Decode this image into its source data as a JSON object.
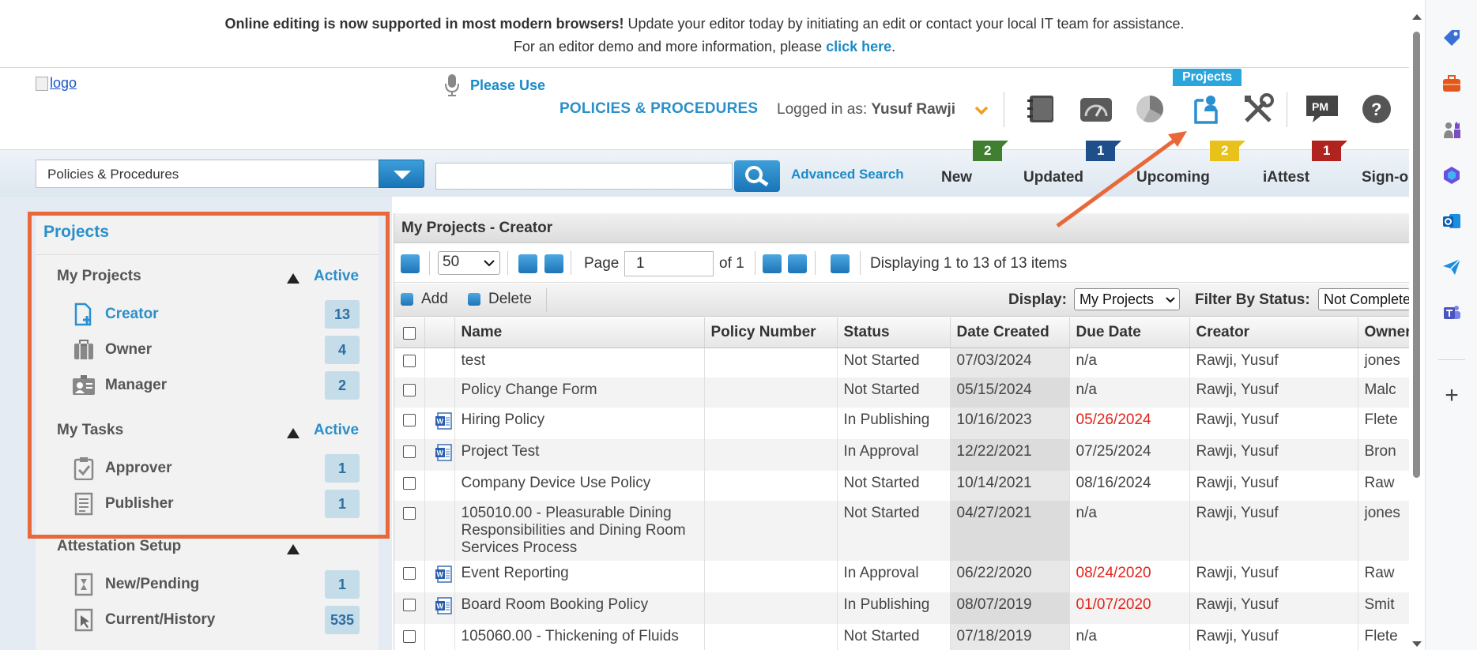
{
  "notice": {
    "bold": "Online editing is now supported in most modern browsers!",
    "text": " Update your editor today by initiating an edit or contact your local IT team for assistance.",
    "line2": "For an editor demo and more information, please ",
    "link": "click here",
    "period": "."
  },
  "header": {
    "logo_alt": "logo",
    "please_use": "Please Use",
    "module_title": "POLICIES & PROCEDURES",
    "logged_in_label": "Logged in as: ",
    "user_name": "Yusuf Rawji",
    "projects_tag": "Projects",
    "toolbar_icons": [
      "binder-icon",
      "dashboard-icon",
      "pie-chart-icon",
      "projects-icon",
      "tools-icon",
      "pm-icon",
      "help-icon"
    ]
  },
  "search": {
    "module_select": "Policies & Procedures",
    "advanced": "Advanced Search",
    "tabs": [
      {
        "label": "New",
        "count": "2",
        "color": "#3f7f2f"
      },
      {
        "label": "Updated",
        "count": "1",
        "color": "#1e4f8a"
      },
      {
        "label": "Upcoming",
        "count": "2",
        "color": "#e8c21a"
      },
      {
        "label": "iAttest",
        "count": "1",
        "color": "#b0231f"
      },
      {
        "label": "Sign-o",
        "count": "",
        "color": ""
      }
    ]
  },
  "left_panel": {
    "title": "Projects",
    "my_projects": "My Projects",
    "active": "Active",
    "creator": "Creator",
    "creator_count": "13",
    "owner": "Owner",
    "owner_count": "4",
    "manager": "Manager",
    "manager_count": "2",
    "my_tasks": "My Tasks",
    "approver": "Approver",
    "approver_count": "1",
    "publisher": "Publisher",
    "publisher_count": "1",
    "attestation": "Attestation Setup",
    "new_pending": "New/Pending",
    "new_pending_count": "1",
    "current_history": "Current/History",
    "current_history_count": "535"
  },
  "grid": {
    "title": "My Projects - Creator",
    "page_size": "50",
    "page_label": "Page",
    "page_value": "1",
    "of_label": "of 1",
    "displaying": "Displaying 1 to 13 of 13 items",
    "add": "Add",
    "delete": "Delete",
    "display_label": "Display:",
    "display_value": "My Projects",
    "filter_label": "Filter By Status:",
    "filter_value": "Not Complete",
    "columns": [
      "Name",
      "Policy Number",
      "Status",
      "Date Created",
      "Due Date",
      "Creator",
      "Owner"
    ],
    "rows": [
      {
        "name": "test",
        "policy": "",
        "status": "Not Started",
        "created": "07/03/2024",
        "due": "n/a",
        "creator": "Rawji, Yusuf",
        "owner": "jones",
        "doc": false,
        "overdue": false
      },
      {
        "name": "Policy Change Form",
        "policy": "",
        "status": "Not Started",
        "created": "05/15/2024",
        "due": "n/a",
        "creator": "Rawji, Yusuf",
        "owner": "Malc",
        "doc": false,
        "overdue": false
      },
      {
        "name": "Hiring Policy",
        "policy": "",
        "status": "In Publishing",
        "created": "10/16/2023",
        "due": "05/26/2024",
        "creator": "Rawji, Yusuf",
        "owner": "Flete",
        "doc": true,
        "overdue": true
      },
      {
        "name": "Project Test",
        "policy": "",
        "status": "In Approval",
        "created": "12/22/2021",
        "due": "07/25/2024",
        "creator": "Rawji, Yusuf",
        "owner": "Bron",
        "doc": true,
        "overdue": false
      },
      {
        "name": "Company Device Use Policy",
        "policy": "",
        "status": "Not Started",
        "created": "10/14/2021",
        "due": "08/16/2024",
        "creator": "Rawji, Yusuf",
        "owner": "Raw",
        "doc": false,
        "overdue": false
      },
      {
        "name": "105010.00 - Pleasurable Dining Responsibilities and Dining Room Services Process",
        "policy": "",
        "status": "Not Started",
        "created": "04/27/2021",
        "due": "n/a",
        "creator": "Rawji, Yusuf",
        "owner": "jones",
        "doc": false,
        "overdue": false
      },
      {
        "name": "Event Reporting",
        "policy": "",
        "status": "In Approval",
        "created": "06/22/2020",
        "due": "08/24/2020",
        "creator": "Rawji, Yusuf",
        "owner": "Raw",
        "doc": true,
        "overdue": true
      },
      {
        "name": "Board Room Booking Policy",
        "policy": "",
        "status": "In Publishing",
        "created": "08/07/2019",
        "due": "01/07/2020",
        "creator": "Rawji, Yusuf",
        "owner": "Smit",
        "doc": true,
        "overdue": true
      },
      {
        "name": "105060.00 - Thickening of Fluids",
        "policy": "",
        "status": "Not Started",
        "created": "07/18/2019",
        "due": "n/a",
        "creator": "Rawji, Yusuf",
        "owner": "Flete",
        "doc": false,
        "overdue": false
      }
    ]
  },
  "colors": {
    "accent": "#2b8fca",
    "highlight": "#e8683a",
    "overdue": "#e2231a"
  }
}
